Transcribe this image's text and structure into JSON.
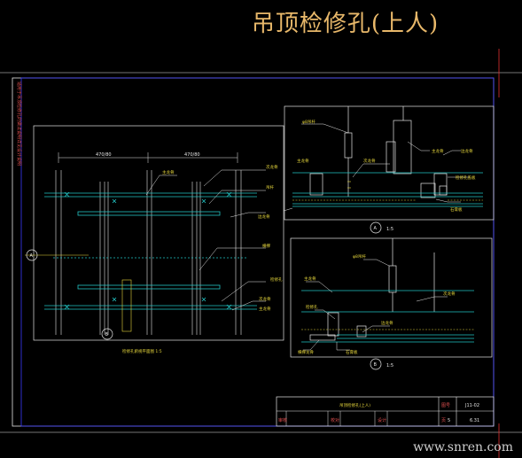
{
  "title": "吊顶检修孔(上人)",
  "watermark": "www.snren.com",
  "plan": {
    "caption": "检修孔俯视平面图  1:5",
    "dims": [
      "470/80",
      "470/80"
    ],
    "markers": [
      "A",
      "B"
    ],
    "labels": [
      "主龙骨",
      "次龙骨",
      "吊杆",
      "边龙骨",
      "横撑",
      "检修孔",
      "次龙骨",
      "主龙骨"
    ]
  },
  "section_a": {
    "marker": "A",
    "scale": "1:5",
    "labels": [
      "φ8吊杆",
      "主龙骨",
      "次龙骨",
      "主龙骨",
      "边龙骨",
      "检修孔盖板",
      "石膏板"
    ]
  },
  "section_b": {
    "marker": "B",
    "scale": "1:5",
    "labels": [
      "φ8吊杆",
      "主龙骨",
      "次龙骨",
      "检修孔",
      "边龙骨",
      "石膏板",
      "横撑龙骨"
    ]
  },
  "side_note": "适用于吊顶检修孔的做法说明详见设计说明",
  "title_block": {
    "name": "吊顶检修孔(上人)",
    "code_label": "图号",
    "code": "J11-02",
    "page_label": "页",
    "page": "6.31",
    "row2": [
      "审核",
      "校对",
      "设计",
      "页"
    ],
    "row2_value": "5"
  },
  "colors": {
    "background": "#000000",
    "frame": "#3a3aff",
    "outline": "#e6e6e6",
    "cyan": "#22c3c3",
    "accent": "#e6d63c",
    "red": "#e03030",
    "title": "#e8b86a"
  }
}
